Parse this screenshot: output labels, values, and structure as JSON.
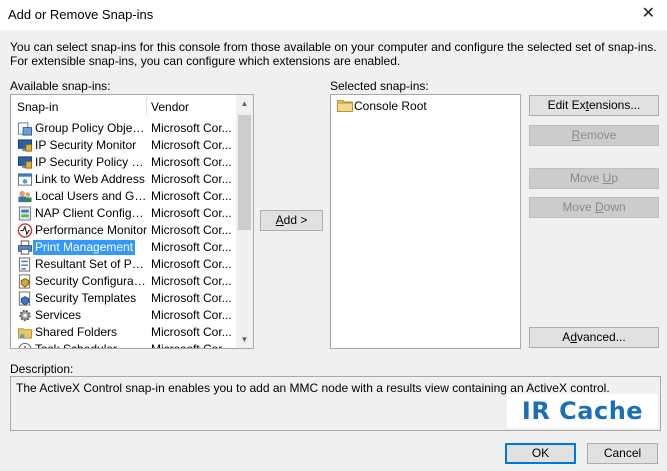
{
  "window": {
    "title": "Add or Remove Snap-ins",
    "close_glyph": "✕"
  },
  "intro_text": "You can select snap-ins for this console from those available on your computer and configure the selected set of snap-ins. For extensible snap-ins, you can configure which extensions are enabled.",
  "available": {
    "label": "Available snap-ins:",
    "headers": {
      "snapin": "Snap-in",
      "vendor": "Vendor"
    },
    "items": [
      {
        "name": "Group Policy Object ...",
        "vendor": "Microsoft Cor...",
        "icon": "group-policy-icon"
      },
      {
        "name": "IP Security Monitor",
        "vendor": "Microsoft Cor...",
        "icon": "ip-security-icon"
      },
      {
        "name": "IP Security Policy M...",
        "vendor": "Microsoft Cor...",
        "icon": "ip-security-icon"
      },
      {
        "name": "Link to Web Address",
        "vendor": "Microsoft Cor...",
        "icon": "web-link-icon"
      },
      {
        "name": "Local Users and Gro...",
        "vendor": "Microsoft Cor...",
        "icon": "users-icon"
      },
      {
        "name": "NAP Client Configur...",
        "vendor": "Microsoft Cor...",
        "icon": "nap-icon"
      },
      {
        "name": "Performance Monitor",
        "vendor": "Microsoft Cor...",
        "icon": "performance-icon"
      },
      {
        "name": "Print Management",
        "vendor": "Microsoft Cor...",
        "icon": "printer-icon",
        "selected": true
      },
      {
        "name": "Resultant Set of Policy",
        "vendor": "Microsoft Cor...",
        "icon": "policy-icon"
      },
      {
        "name": "Security Configurati...",
        "vendor": "Microsoft Cor...",
        "icon": "security-icon"
      },
      {
        "name": "Security Templates",
        "vendor": "Microsoft Cor...",
        "icon": "template-icon"
      },
      {
        "name": "Services",
        "vendor": "Microsoft Cor...",
        "icon": "gear-icon"
      },
      {
        "name": "Shared Folders",
        "vendor": "Microsoft Cor...",
        "icon": "shared-folder-icon"
      },
      {
        "name": "Task Scheduler",
        "vendor": "Microsoft Cor...",
        "icon": "clock-icon"
      }
    ]
  },
  "add_button": "Add >",
  "selected": {
    "label": "Selected snap-ins:",
    "root": "Console Root",
    "root_icon": "folder-icon"
  },
  "buttons": {
    "edit_extensions": "Edit Extensions...",
    "remove": "Remove",
    "move_up": "Move Up",
    "move_down": "Move Down",
    "advanced": "Advanced...",
    "ok": "OK",
    "cancel": "Cancel"
  },
  "description": {
    "label": "Description:",
    "text": "The ActiveX Control snap-in enables you to add an MMC node with a results view containing an ActiveX control."
  },
  "watermark": "IR Cache",
  "colors": {
    "selection": "#3399ff",
    "accent": "#0078d7",
    "watermark": "#1b6fb9"
  }
}
